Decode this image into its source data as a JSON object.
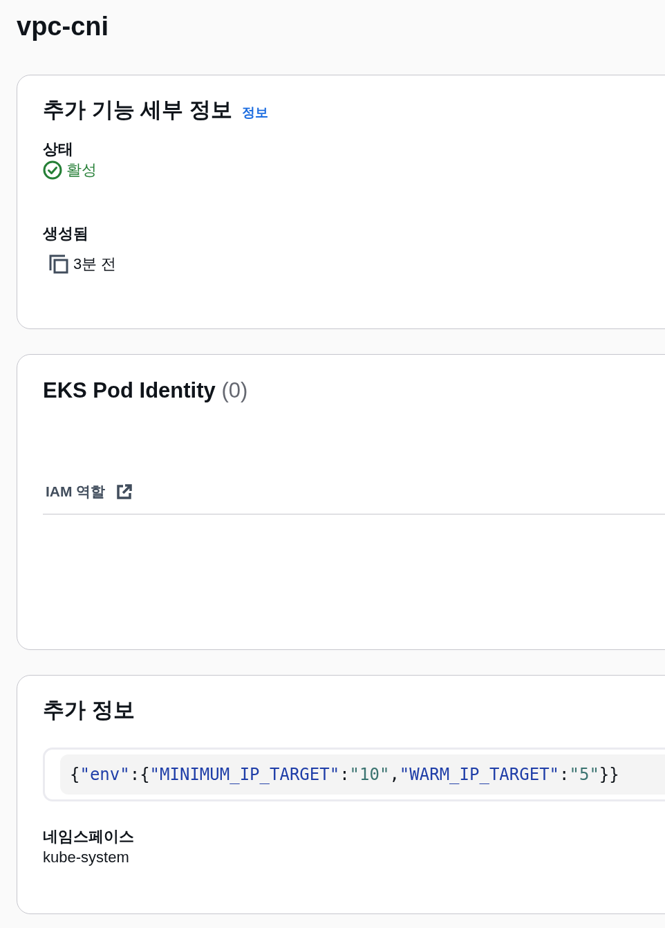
{
  "page_title": "vpc-cni",
  "details": {
    "heading": "추가 기능 세부 정보",
    "info_link": "정보",
    "status_label": "상태",
    "status": {
      "text": "활성",
      "kind": "success"
    },
    "created_label": "생성됨",
    "created_value": "3분 전"
  },
  "pod_identity": {
    "heading": "EKS Pod Identity",
    "count": "(0)",
    "columns": [
      {
        "label": "IAM 역할",
        "external": true
      }
    ]
  },
  "additional": {
    "heading": "추가 정보",
    "code_tokens": [
      {
        "kind": "punct",
        "text": "{"
      },
      {
        "kind": "key",
        "text": "\"env\""
      },
      {
        "kind": "punct",
        "text": ":{"
      },
      {
        "kind": "key",
        "text": "\"MINIMUM_IP_TARGET\""
      },
      {
        "kind": "punct",
        "text": ":"
      },
      {
        "kind": "value",
        "text": "\"10\""
      },
      {
        "kind": "punct",
        "text": ","
      },
      {
        "kind": "key",
        "text": "\"WARM_IP_TARGET\""
      },
      {
        "kind": "punct",
        "text": ":"
      },
      {
        "kind": "value",
        "text": "\"5\""
      },
      {
        "kind": "punct",
        "text": "}}"
      }
    ],
    "namespace_label": "네임스페이스",
    "namespace_value": "kube-system"
  }
}
